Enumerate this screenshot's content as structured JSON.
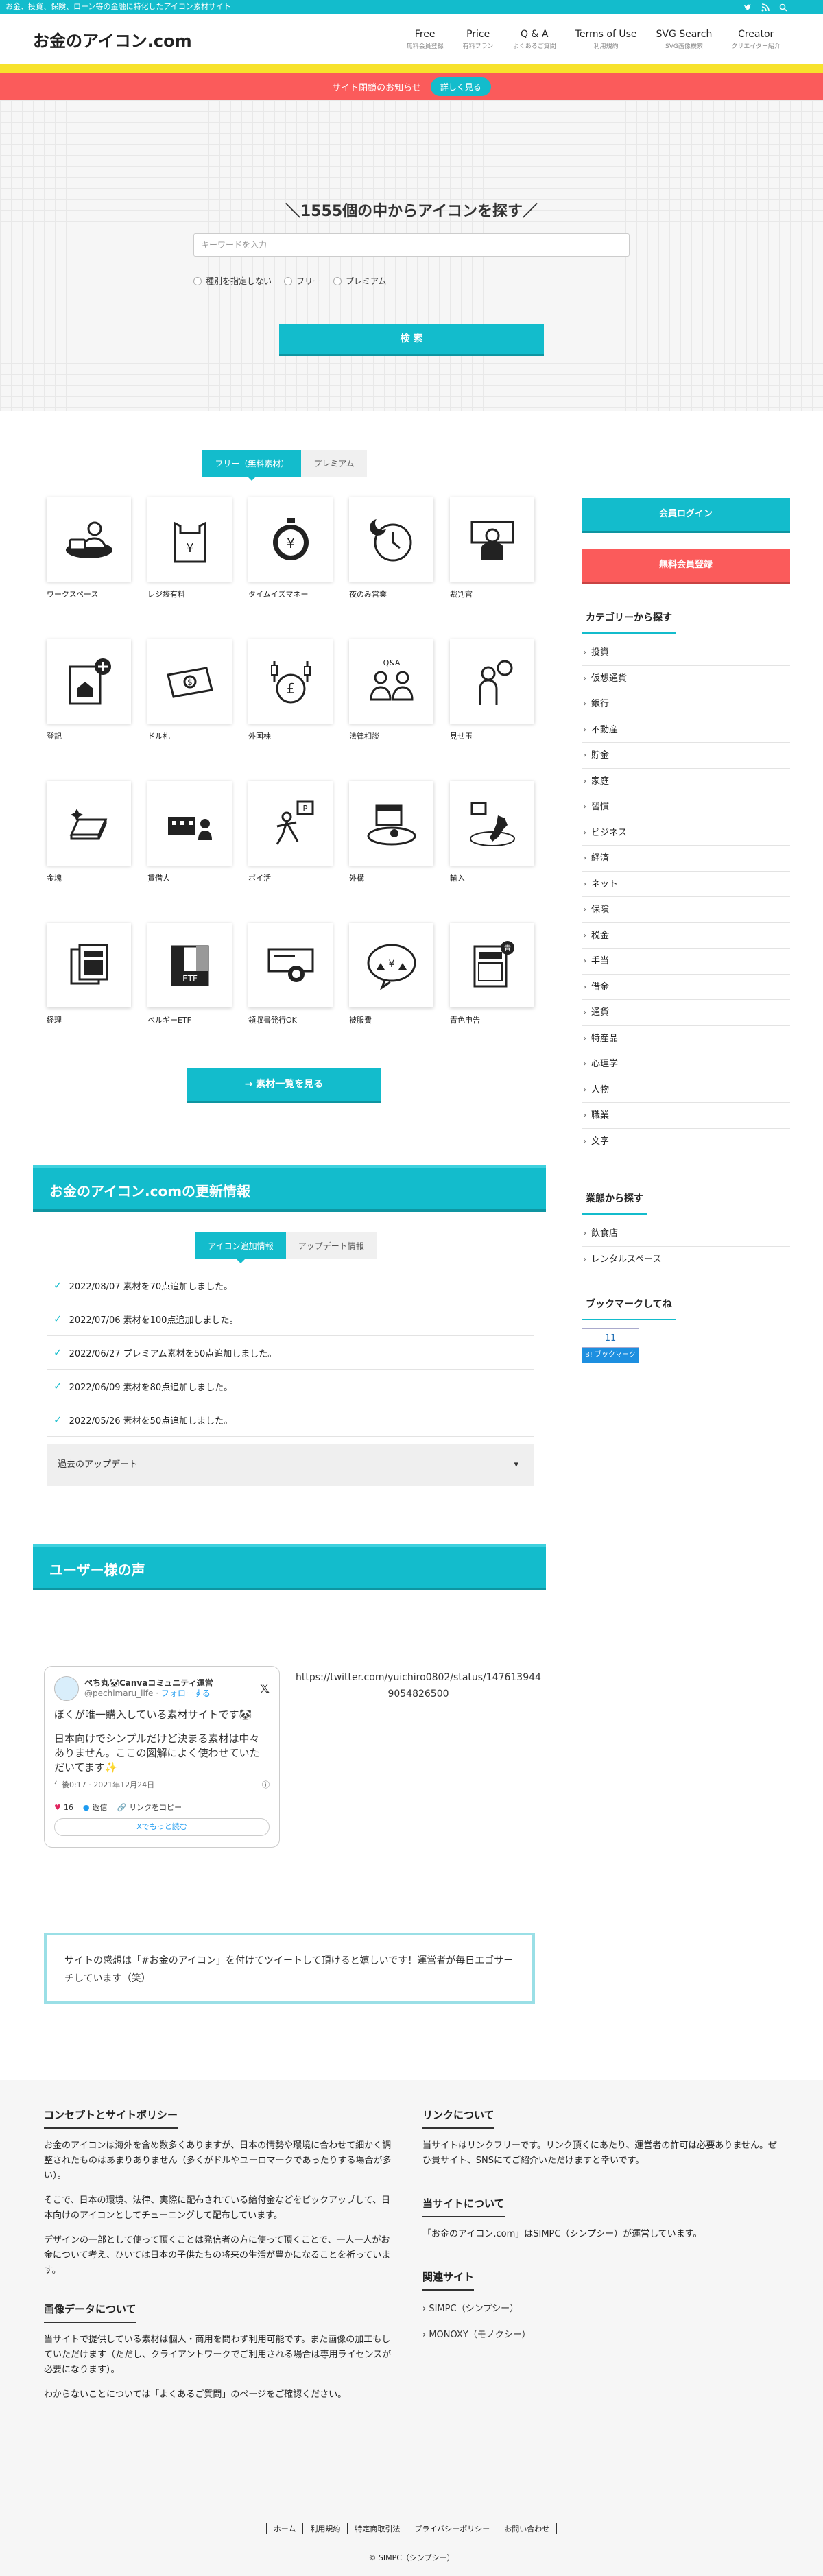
{
  "topbar": {
    "tagline": "お金、投資、保険、ローン等の金融に特化したアイコン素材サイト"
  },
  "header": {
    "logo": "お金のアイコン.com",
    "nav": [
      {
        "title": "Free",
        "sub": "無料会員登録"
      },
      {
        "title": "Price",
        "sub": "有料プラン"
      },
      {
        "title": "Q & A",
        "sub": "よくあるご質問"
      },
      {
        "title": "Terms of Use",
        "sub": "利用規約"
      },
      {
        "title": "SVG Search",
        "sub": "SVG画像検索"
      },
      {
        "title": "Creator",
        "sub": "クリエイター紹介"
      }
    ]
  },
  "notice": {
    "text": "サイト閉鎖のお知らせ",
    "button": "詳しく見る"
  },
  "hero": {
    "heading": "＼1555個の中からアイコンを探す／",
    "placeholder": "キーワードを入力",
    "radios": [
      "種別を指定しない",
      "フリー",
      "プレミアム"
    ],
    "search_button": "検 索"
  },
  "icons": {
    "tabs": [
      "フリー（無料素材）",
      "プレミアム"
    ],
    "items": [
      "ワークスペース",
      "レジ袋有料",
      "タイムイズマネー",
      "夜のみ営業",
      "裁判官",
      "登記",
      "ドル札",
      "外国株",
      "法律相談",
      "見せ玉",
      "金塊",
      "賃借人",
      "ポイ活",
      "外構",
      "輸入",
      "経理",
      "ベルギーETF",
      "領収書発行OK",
      "被服費",
      "青色申告"
    ],
    "more_button": "→ 素材一覧を見る"
  },
  "updates": {
    "title": "お金のアイコン.comの更新情報",
    "tabs": [
      "アイコン追加情報",
      "アップデート情報"
    ],
    "items": [
      "2022/08/07 素材を70点追加しました。",
      "2022/07/06 素材を100点追加しました。",
      "2022/06/27 プレミアム素材を50点追加しました。",
      "2022/06/09 素材を80点追加しました。",
      "2022/05/26 素材を50点追加しました。"
    ],
    "past": "過去のアップデート"
  },
  "voices": {
    "title": "ユーザー様の声",
    "tweet": {
      "name": "ぺち丸🐼Canvaコミュニティ運営",
      "handle": "@pechimaru_life",
      "follow": "フォローする",
      "body1": "ぼくが唯一購入している素材サイトです🐼",
      "body2": "日本向けでシンプルだけど決まる素材は中々ありません。ここの図解によく使わせていただいてます✨",
      "time": "午後0:17 · 2021年12月24日",
      "likes": "16",
      "reply": "返信",
      "copy": "リンクをコピー",
      "more": "Xでもっと読む"
    },
    "url": "https://twitter.com/yuichiro0802/status/1476139449054826500",
    "note": "サイトの感想は「#お金のアイコン」を付けてツイートして頂けると嬉しいです！運営者が毎日エゴサーチしています（笑）"
  },
  "sidebar": {
    "login": "会員ログイン",
    "register": "無料会員登録",
    "categories_title": "カテゴリーから探す",
    "categories": [
      "投資",
      "仮想通貨",
      "銀行",
      "不動産",
      "貯金",
      "家庭",
      "習慣",
      "ビジネス",
      "経済",
      "ネット",
      "保険",
      "税金",
      "手当",
      "借金",
      "通貨",
      "特産品",
      "心理学",
      "人物",
      "職業",
      "文字"
    ],
    "industry_title": "業態から探す",
    "industries": [
      "飲食店",
      "レンタルスペース"
    ],
    "bookmark_title": "ブックマークしてね",
    "bookmark_count": "11",
    "bookmark_label": "B! ブックマーク"
  },
  "footer": {
    "concept_title": "コンセプトとサイトポリシー",
    "concept": [
      "お金のアイコンは海外を含め数多くありますが、日本の情勢や環境に合わせて細かく調整されたものはあまりありません（多くがドルやユーロマークであったりする場合が多い）。",
      "そこで、日本の環境、法律、実際に配布されている給付金などをピックアップして、日本向けのアイコンとしてチューニングして配布しています。",
      "デザインの一部として使って頂くことは発信者の方に使って頂くことで、一人一人がお金について考え、ひいては日本の子供たちの将来の生活が豊かになることを祈っています。"
    ],
    "image_title": "画像データについて",
    "image": [
      "当サイトで提供している素材は個人・商用を問わず利用可能です。また画像の加工もしていただけます（ただし、クライアントワークでご利用される場合は専用ライセンスが必要になります）。",
      "わからないことについては「よくあるご質問」のページをご確認ください。"
    ],
    "link_title": "リンクについて",
    "link": "当サイトはリンクフリーです。リンク頂くにあたり、運営者の許可は必要ありません。ぜひ貴サイト、SNSにてご紹介いただけますと幸いです。",
    "about_title": "当サイトについて",
    "about": "「お金のアイコン.com」はSIMPC（シンプシー）が運営しています。",
    "related_title": "関連サイト",
    "related": [
      "SIMPC（シンプシー）",
      "MONOXY（モノクシー）"
    ],
    "links": [
      "ホーム",
      "利用規約",
      "特定商取引法",
      "プライバシーポリシー",
      "お問い合わせ"
    ],
    "copyright": "© SIMPC（シンプシー）"
  },
  "colors": {
    "accent": "#13bccc",
    "red": "#fb5b5b",
    "yellow": "#f7e22c"
  }
}
